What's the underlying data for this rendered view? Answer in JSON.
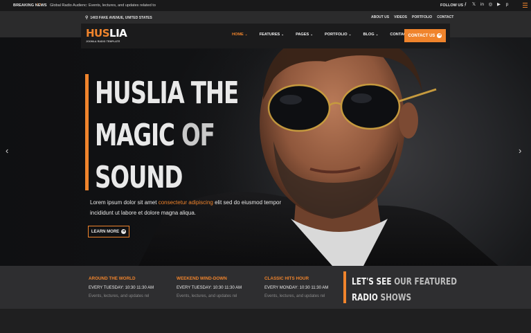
{
  "topbar": {
    "breaking_label": "BREAKING NEWS",
    "arrows": "‹ ›",
    "breaking_text": "Global Radio Audienc: Events, lectures, and updates related to",
    "follow_label": "FOLLOW US :",
    "social_icons": [
      "facebook-icon",
      "x-icon",
      "linkedin-icon",
      "instagram-icon",
      "youtube-icon",
      "pinterest-icon"
    ],
    "social_glyphs": [
      "f",
      "𝕏",
      "in",
      "◎",
      "▶",
      "p"
    ]
  },
  "infobar": {
    "address": "1403 FAKE AVENUE, UNITED STATES",
    "links": [
      "ABOUT US",
      "VIDEOS",
      "PORTFOLIO",
      "CONTACT"
    ]
  },
  "logo": {
    "part1": "HUS",
    "part2": "LIA",
    "tagline": "JOOMLA RADIO TEMPLATE"
  },
  "nav": {
    "items": [
      {
        "label": "HOME",
        "active": true,
        "dropdown": true
      },
      {
        "label": "FEATURES",
        "active": false,
        "dropdown": true
      },
      {
        "label": "PAGES",
        "active": false,
        "dropdown": true
      },
      {
        "label": "PORTFOLIO",
        "active": false,
        "dropdown": true
      },
      {
        "label": "BLOG",
        "active": false,
        "dropdown": true
      },
      {
        "label": "CONTACT",
        "active": false,
        "dropdown": false
      }
    ],
    "cta": "CONTACT US"
  },
  "hero": {
    "title_line1": "HUSLIA THE",
    "title_line2_a": "MAGIC ",
    "title_line2_b": "OF",
    "title_line3": "SOUND",
    "text_a": "Lorem ipsum dolor sit amet ",
    "text_link": "consectetur adipiscing",
    "text_b": " elit sed do eiusmod tempor incididunt ut labore et dolore magna aliqua.",
    "button": "LEARN MORE"
  },
  "shows": {
    "items": [
      {
        "title": "AROUND THE WORLD",
        "time": "EVERY TUESDAY: 10:30 11:30 AM",
        "desc": "Events, lectures, and updates rel"
      },
      {
        "title": "WEEKEND WIND-DOWN",
        "time": "EVERY TUESDAY: 10:30 11:30 AM",
        "desc": "Events, lectures, and updates rel"
      },
      {
        "title": "CLASSIC HITS HOUR",
        "time": "EVERY MONDAY: 10:30 11:30 AM",
        "desc": "Events, lectures, and updates rel"
      }
    ],
    "featured_a": "LET'S SEE ",
    "featured_b": "OUR FEATURED",
    "featured_c": "RADIO ",
    "featured_d": "SHOWS"
  },
  "colors": {
    "accent": "#f0842c",
    "background": "#1e1e1f"
  }
}
